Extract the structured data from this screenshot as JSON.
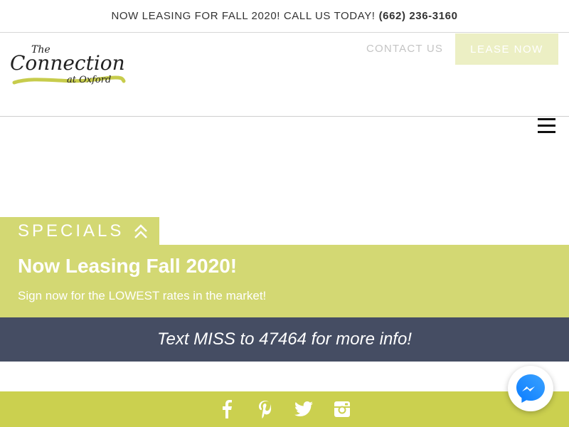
{
  "announcement": {
    "text": "NOW LEASING FOR FALL 2020! CALL US TODAY!",
    "phone": "(662) 236-3160"
  },
  "header": {
    "logo_line1": "The",
    "logo_line2": "Connection",
    "logo_line3": "at Oxford",
    "contact_label": "CONTACT US",
    "lease_label": "LEASE NOW"
  },
  "specials": {
    "tab_label": "SPECIALS",
    "title": "Now Leasing Fall 2020!",
    "subtitle": "Sign now for the LOWEST rates in the market!"
  },
  "text_info": "Text MISS to 47464 for more info!",
  "footer": {
    "social_icons": [
      "facebook-icon",
      "pinterest-icon",
      "twitter-icon",
      "instagram-icon"
    ]
  },
  "colors": {
    "accent_green": "#d3d873",
    "footer_green": "#cbd04f",
    "lease_button": "#ecefc4",
    "navy_bar": "#454d63",
    "messenger": "#1e88ff"
  }
}
